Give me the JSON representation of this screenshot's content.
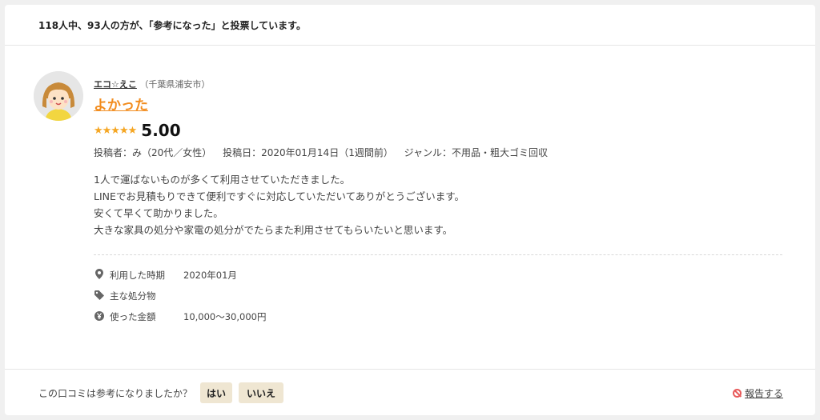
{
  "summary": {
    "text": "118人中、93人の方が、「参考になった」と投票しています。"
  },
  "review": {
    "author": "エコ☆えこ",
    "location": "（千葉県浦安市）",
    "title": "よかった",
    "stars": "★★★★★",
    "rating": 5.0,
    "score": "5.00",
    "poster": "投稿者：み（20代／女性）",
    "posted": "投稿日：2020年01月14日（1週間前）",
    "genre": "ジャンル：不用品・粗大ゴミ回収",
    "body": [
      "1人で運ばないものが多くて利用させていただきました。",
      "LINEでお見積もりできて便利ですぐに対応していただいてありがとうございます。",
      "安くて早くて助かりました。",
      "大きな家具の処分や家電の処分がでたらまた利用させてもらいたいと思います。"
    ],
    "details": [
      {
        "icon": "location-pin-icon",
        "label": "利用した時期",
        "value": "2020年01月"
      },
      {
        "icon": "tag-icon",
        "label": "主な処分物",
        "value": ""
      },
      {
        "icon": "yen-icon",
        "label": "使った金額",
        "value": "10,000〜30,000円"
      }
    ]
  },
  "footer": {
    "question": "この口コミは参考になりましたか？",
    "yes_label": "はい",
    "no_label": "いいえ",
    "report_label": "報告する"
  },
  "colors": {
    "title": "#f28c1e",
    "stars": "#f5a623",
    "button_bg": "#efe6d2",
    "report_icon": "#e85a5a"
  }
}
